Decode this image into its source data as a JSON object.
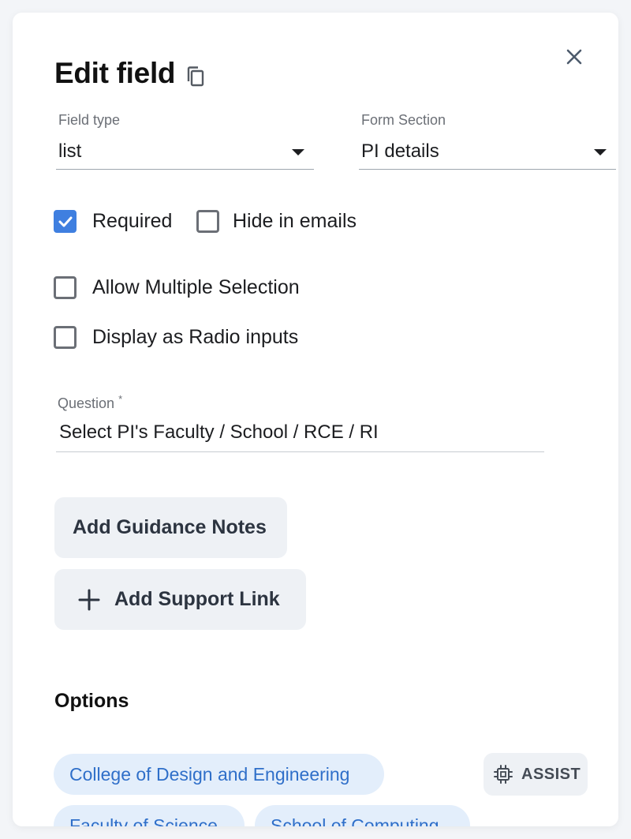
{
  "dialog": {
    "title": "Edit field",
    "close_icon": "close-icon",
    "copy_icon": "copy-icon"
  },
  "field_type": {
    "label": "Field type",
    "value": "list"
  },
  "form_section": {
    "label": "Form Section",
    "value": "PI details"
  },
  "checkboxes": {
    "required": {
      "label": "Required",
      "checked": true
    },
    "hide_in_emails": {
      "label": "Hide in emails",
      "checked": false
    },
    "allow_multiple": {
      "label": "Allow Multiple Selection",
      "checked": false
    },
    "display_radio": {
      "label": "Display as Radio inputs",
      "checked": false
    }
  },
  "question": {
    "label": "Question",
    "required_marker": "*",
    "value": "Select PI's Faculty / School / RCE / RI"
  },
  "buttons": {
    "guidance_notes": "Add Guidance Notes",
    "support_link": "Add Support Link",
    "support_link_icon": "plus-icon",
    "assist": "ASSIST",
    "assist_icon": "chip-icon"
  },
  "options": {
    "heading": "Options",
    "items": [
      "College of Design and Engineering",
      "Faculty of Science",
      "School of Computing"
    ]
  },
  "colors": {
    "accent": "#3f7fe0",
    "chip_bg": "#e3eefb",
    "chip_text": "#2f6fc9",
    "button_bg": "#eef1f5"
  }
}
